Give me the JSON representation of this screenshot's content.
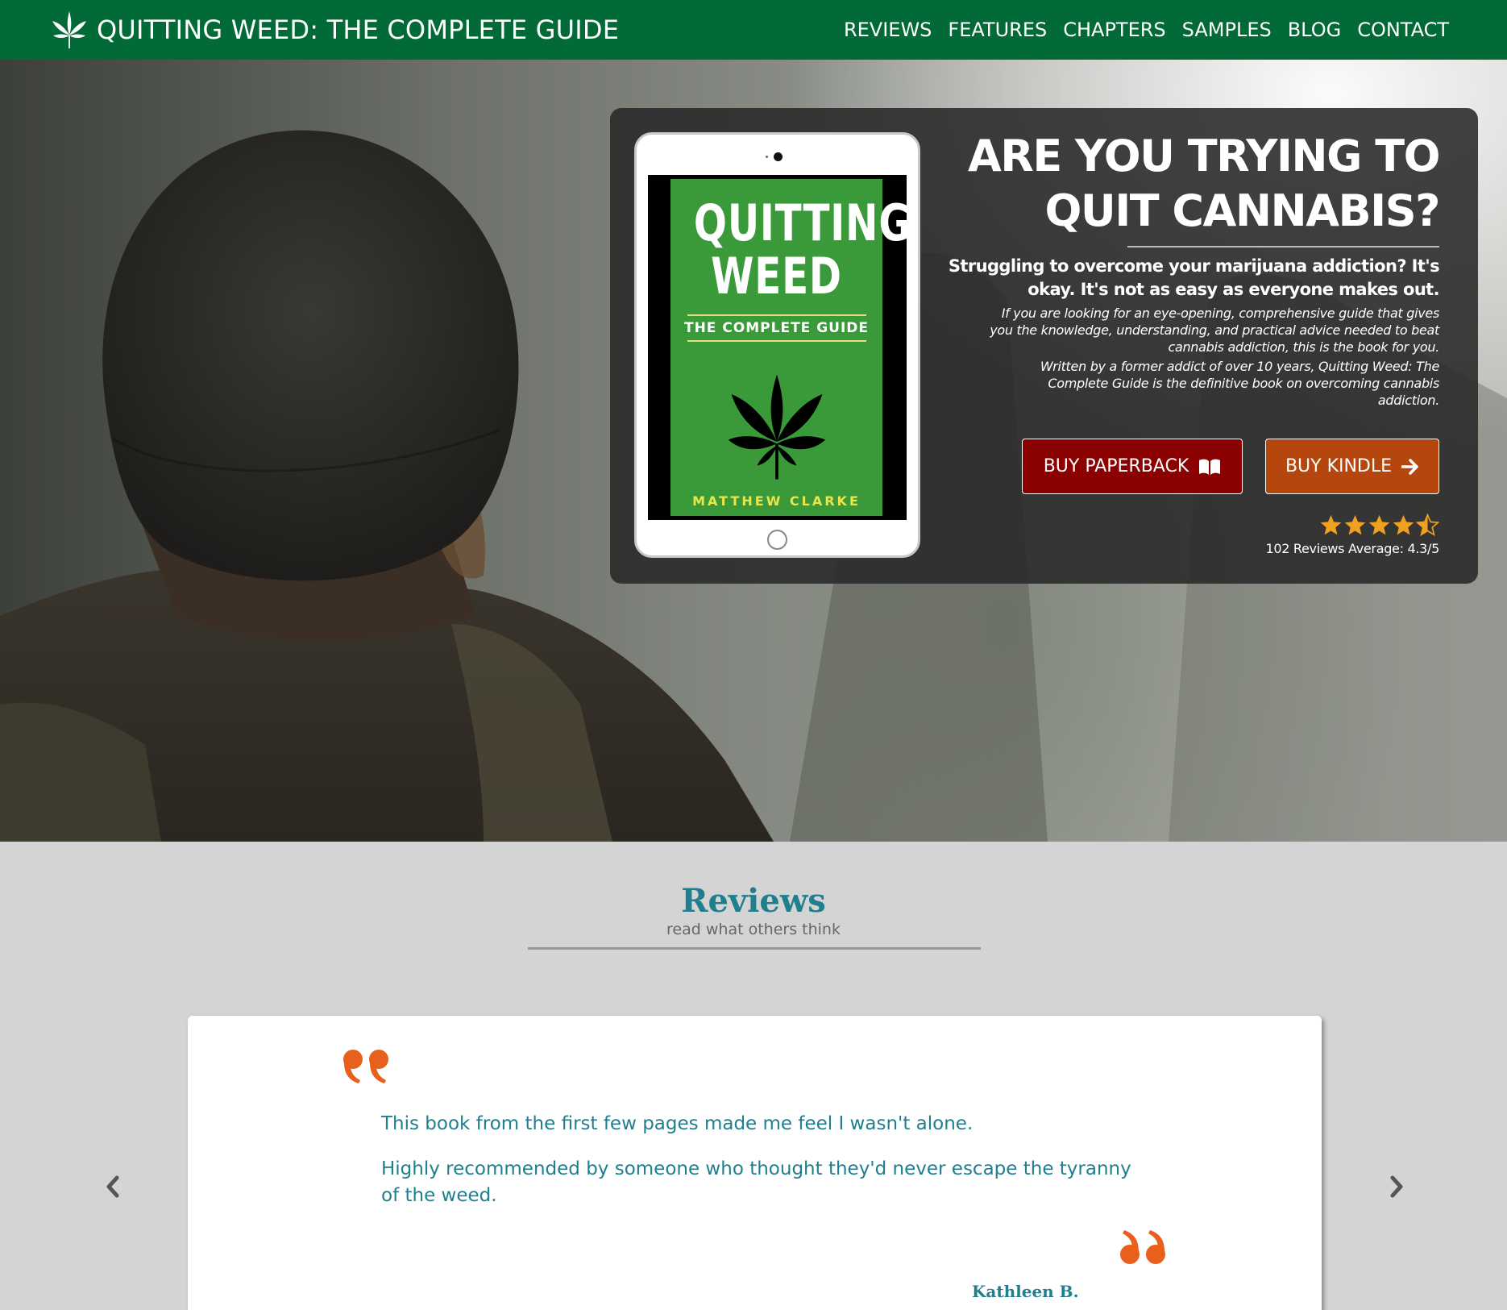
{
  "navbar": {
    "brand_icon": "cannabis-leaf-icon",
    "brand_title": "QUITTING WEED: THE COMPLETE GUIDE",
    "links": [
      "REVIEWS",
      "FEATURES",
      "CHAPTERS",
      "SAMPLES",
      "BLOG",
      "CONTACT"
    ]
  },
  "hero": {
    "heading": "ARE YOU TRYING TO QUIT CANNABIS?",
    "subheading": "Struggling to overcome your marijuana addiction? It's okay. It's not as easy as everyone makes out.",
    "paragraph1": "If you are looking for an eye-opening, comprehensive guide that gives you the knowledge, understanding, and practical advice needed to beat cannabis addiction, this is the book for you.",
    "paragraph2": "Written by a former addict of over 10 years, Quitting Weed: The Complete Guide is the definitive book on overcoming cannabis addiction.",
    "book_cover": {
      "title_line1": "QUITTING",
      "title_line2": "WEED",
      "subtitle": "THE COMPLETE GUIDE",
      "author": "MATTHEW CLARKE"
    },
    "buttons": {
      "paperback_label": "BUY PAPERBACK",
      "paperback_icon": "open-book-icon",
      "kindle_label": "BUY KINDLE",
      "kindle_icon": "arrow-right-icon"
    },
    "rating": {
      "stars": 4.5,
      "text": "102 Reviews Average: 4.3/5"
    }
  },
  "reviews": {
    "title": "Reviews",
    "subtitle": "read what others think",
    "current": {
      "line1": "This book from the first few pages made me feel I wasn't alone.",
      "line2": "Highly recommended by someone who thought they'd never escape the tyranny of the weed.",
      "author": "Kathleen B."
    },
    "prev_icon": "chevron-left-icon",
    "next_icon": "chevron-right-icon"
  },
  "colors": {
    "navbar": "#026a36",
    "accent_teal": "#1f7f8e",
    "quote_orange": "#e8601c",
    "paperback_button": "#8b0000",
    "kindle_button": "#b5460e",
    "star": "#f0a020"
  }
}
